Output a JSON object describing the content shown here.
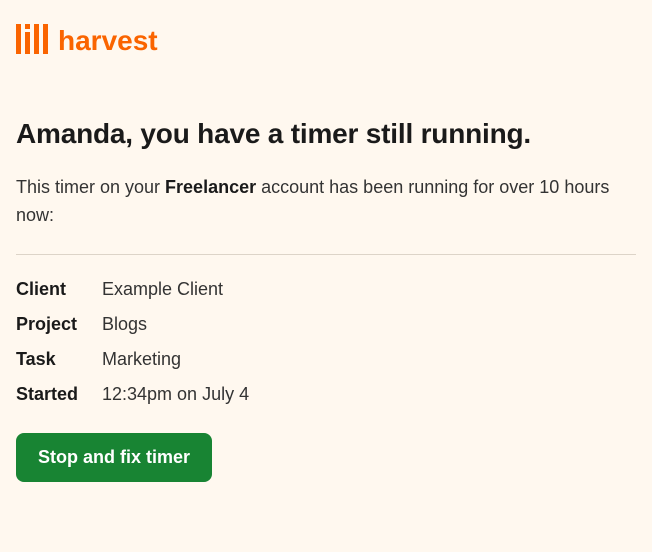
{
  "brand": {
    "name": "harvest",
    "color": "#fa6400"
  },
  "headline": "Amanda, you have a timer still running.",
  "subtext": {
    "prefix": "This timer on your ",
    "account": "Freelancer",
    "suffix": " account has been running for over 10 hours now:"
  },
  "details": {
    "client_label": "Client",
    "client_value": "Example Client",
    "project_label": "Project",
    "project_value": "Blogs",
    "task_label": "Task",
    "task_value": "Marketing",
    "started_label": "Started",
    "started_value": "12:34pm on July 4"
  },
  "cta_label": "Stop and fix timer"
}
